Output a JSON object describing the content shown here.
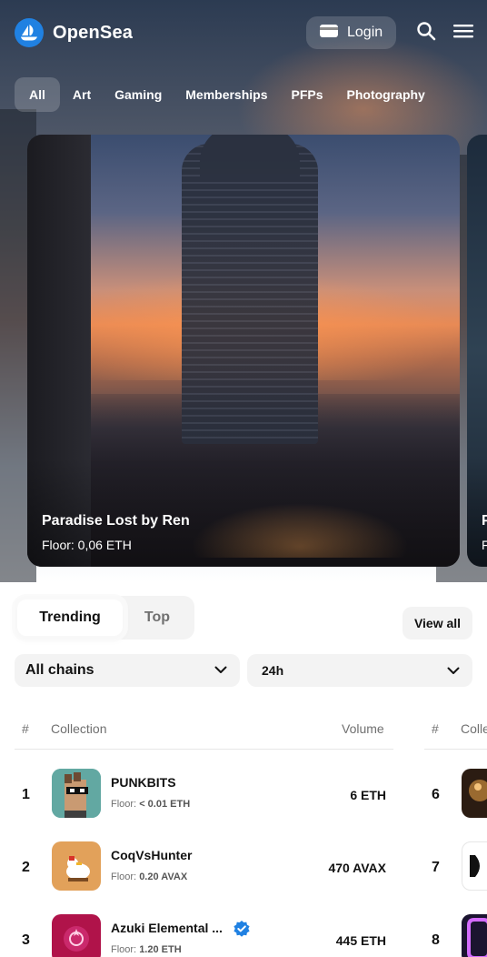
{
  "header": {
    "brand": "OpenSea",
    "login_label": "Login"
  },
  "categories": [
    "All",
    "Art",
    "Gaming",
    "Memberships",
    "PFPs",
    "Photography"
  ],
  "featured": [
    {
      "title": "Paradise Lost by Ren",
      "floor": "Floor: 0,06 ETH"
    },
    {
      "title": "P",
      "floor": "F"
    }
  ],
  "trending": {
    "tabs": [
      "Trending",
      "Top"
    ],
    "view_all": "View all",
    "chain_filter": "All chains",
    "period_filter": "24h"
  },
  "table": {
    "headers": {
      "rank": "#",
      "collection": "Collection",
      "volume": "Volume"
    },
    "rows_left": [
      {
        "rank": "1",
        "name": "PUNKBITS",
        "floor_label": "Floor:",
        "floor_value": "< 0.01 ETH",
        "volume": "6 ETH",
        "verified": false
      },
      {
        "rank": "2",
        "name": "CoqVsHunter",
        "floor_label": "Floor:",
        "floor_value": "0.20 AVAX",
        "volume": "470 AVAX",
        "verified": false
      },
      {
        "rank": "3",
        "name": "Azuki Elemental ...",
        "floor_label": "Floor:",
        "floor_value": "1.20 ETH",
        "volume": "445 ETH",
        "verified": true
      }
    ],
    "rows_right": [
      {
        "rank": "6"
      },
      {
        "rank": "7"
      },
      {
        "rank": "8"
      }
    ],
    "right_headers": {
      "rank": "#",
      "collection": "Colle"
    }
  },
  "colors": {
    "brand_blue": "#2081e2",
    "verified_blue": "#2081e2",
    "muted_text": "#707070"
  }
}
